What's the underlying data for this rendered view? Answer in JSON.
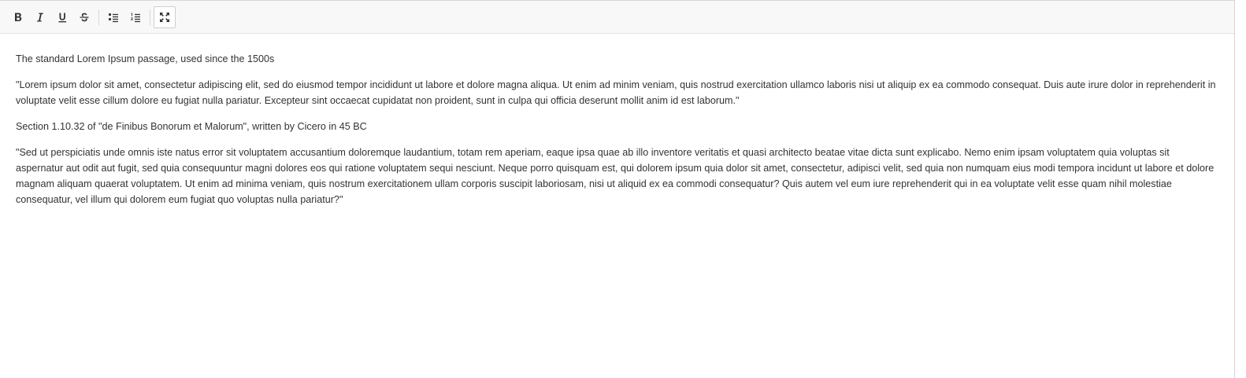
{
  "toolbar": {
    "buttons": [
      {
        "name": "bold",
        "icon": "bold-icon",
        "active": false
      },
      {
        "name": "italic",
        "icon": "italic-icon",
        "active": false
      },
      {
        "name": "underline",
        "icon": "underline-icon",
        "active": false
      },
      {
        "name": "strikethrough",
        "icon": "strikethrough-icon",
        "active": false
      },
      {
        "name": "bulleted-list",
        "icon": "bulleted-list-icon",
        "active": false
      },
      {
        "name": "numbered-list",
        "icon": "numbered-list-icon",
        "active": false
      },
      {
        "name": "fullscreen",
        "icon": "fullscreen-icon",
        "active": true
      }
    ]
  },
  "content": {
    "paragraphs": [
      "The standard Lorem Ipsum passage, used since the 1500s",
      "\"Lorem ipsum dolor sit amet, consectetur adipiscing elit, sed do eiusmod tempor incididunt ut labore et dolore magna aliqua. Ut enim ad minim veniam, quis nostrud exercitation ullamco laboris nisi ut aliquip ex ea commodo consequat. Duis aute irure dolor in reprehenderit in voluptate velit esse cillum dolore eu fugiat nulla pariatur. Excepteur sint occaecat cupidatat non proident, sunt in culpa qui officia deserunt mollit anim id est laborum.\"",
      "Section 1.10.32 of \"de Finibus Bonorum et Malorum\", written by Cicero in 45 BC",
      "\"Sed ut perspiciatis unde omnis iste natus error sit voluptatem accusantium doloremque laudantium, totam rem aperiam, eaque ipsa quae ab illo inventore veritatis et quasi architecto beatae vitae dicta sunt explicabo. Nemo enim ipsam voluptatem quia voluptas sit aspernatur aut odit aut fugit, sed quia consequuntur magni dolores eos qui ratione voluptatem sequi nesciunt. Neque porro quisquam est, qui dolorem ipsum quia dolor sit amet, consectetur, adipisci velit, sed quia non numquam eius modi tempora incidunt ut labore et dolore magnam aliquam quaerat voluptatem. Ut enim ad minima veniam, quis nostrum exercitationem ullam corporis suscipit laboriosam, nisi ut aliquid ex ea commodi consequatur? Quis autem vel eum iure reprehenderit qui in ea voluptate velit esse quam nihil molestiae consequatur, vel illum qui dolorem eum fugiat quo voluptas nulla pariatur?\""
    ]
  },
  "colors": {
    "text": "#333333",
    "toolbar_bg": "#f8f8f8",
    "border": "#d6d6d6"
  }
}
